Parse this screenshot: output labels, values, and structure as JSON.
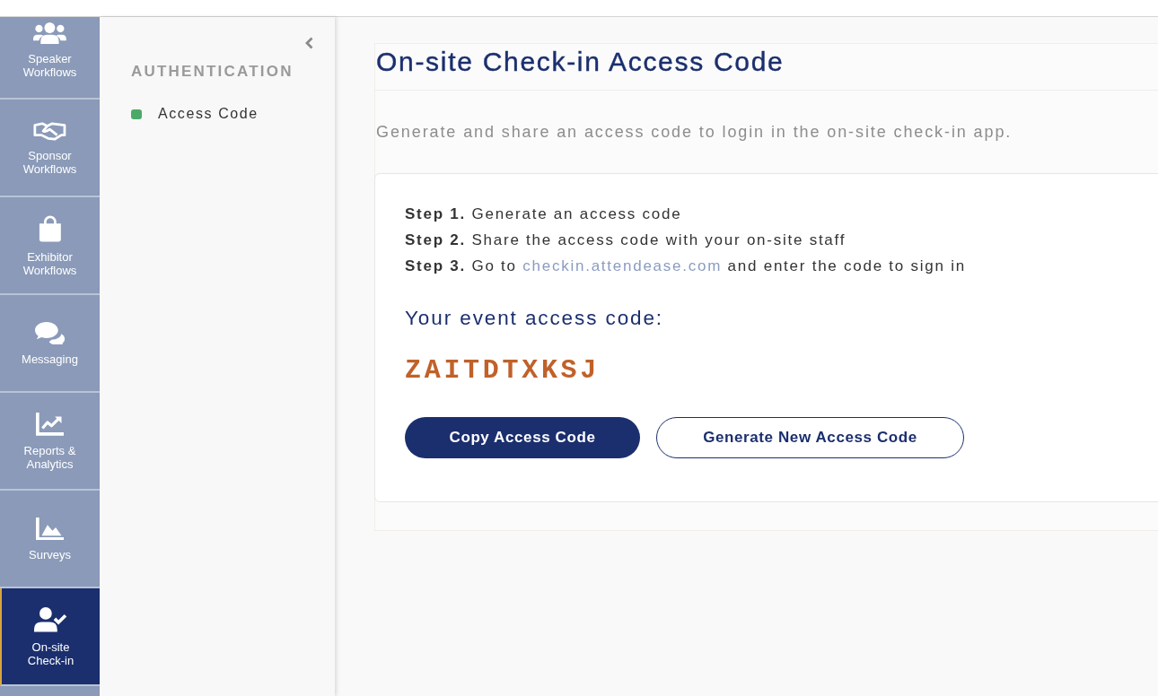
{
  "nav": {
    "items": [
      {
        "label": "Speaker Workflows",
        "selected": false
      },
      {
        "label": "Sponsor Workflows",
        "selected": false
      },
      {
        "label": "Exhibitor Workflows",
        "selected": false
      },
      {
        "label": "Messaging",
        "selected": false
      },
      {
        "label": "Reports & Analytics",
        "selected": false
      },
      {
        "label": "Surveys",
        "selected": false
      },
      {
        "label": "On-site Check-in",
        "selected": true
      }
    ]
  },
  "subnav": {
    "title": "AUTHENTICATION",
    "items": [
      {
        "label": "Access Code",
        "selected": true
      }
    ]
  },
  "page": {
    "title": "On-site Check-in Access Code",
    "description": "Generate and share an access code to login in the on-site check-in app.",
    "steps": [
      {
        "text": "**Step 1.** Generate an access code"
      },
      {
        "text": "**Step 2.** Share the access code with your on-site staff"
      },
      {
        "text": "**Step 3.** Go to ",
        "link": "checkin.attendease.com",
        "text_after": " and enter the code to sign in"
      }
    ],
    "code_label": "Your event access code:",
    "access_code": "ZAITDTXKSJ",
    "buttons": [
      {
        "label": "Copy Access Code",
        "kind": "primary"
      },
      {
        "label": "Generate New Access Code",
        "kind": "secondary"
      }
    ]
  }
}
